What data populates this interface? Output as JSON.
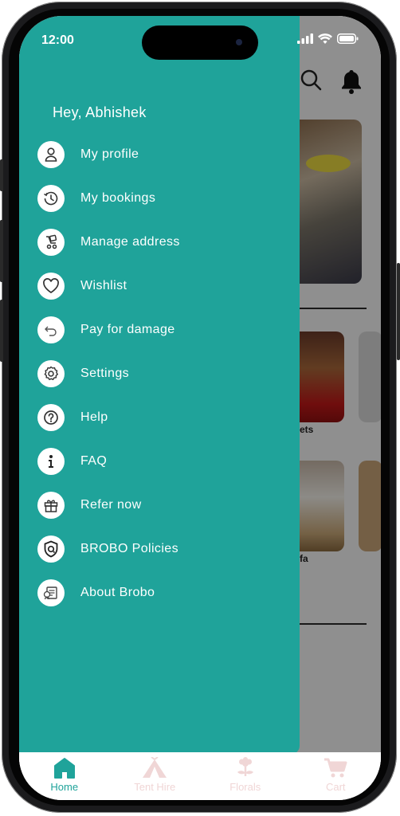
{
  "status_bar": {
    "time": "12:00"
  },
  "drawer": {
    "greeting": "Hey, Abhishek",
    "items": [
      {
        "label": "My profile",
        "icon": "person-icon"
      },
      {
        "label": "My bookings",
        "icon": "clock-history-icon"
      },
      {
        "label": "Manage address",
        "icon": "address-cart-icon"
      },
      {
        "label": "Wishlist",
        "icon": "heart-icon"
      },
      {
        "label": "Pay for damage",
        "icon": "return-arrow-icon"
      },
      {
        "label": "Settings",
        "icon": "gear-icon"
      },
      {
        "label": "Help",
        "icon": "help-icon"
      },
      {
        "label": "FAQ",
        "icon": "info-icon"
      },
      {
        "label": "Refer now",
        "icon": "gift-icon"
      },
      {
        "label": "BROBO Policies",
        "icon": "shield-icon"
      },
      {
        "label": "About Brobo",
        "icon": "document-icon"
      }
    ]
  },
  "background": {
    "card_label_1": "ets",
    "card_label_2": "fa"
  },
  "bottom_nav": {
    "items": [
      {
        "label": "Home",
        "icon": "home-icon",
        "active": true
      },
      {
        "label": "Tent Hire",
        "icon": "tent-icon",
        "active": false
      },
      {
        "label": "Florals",
        "icon": "flower-icon",
        "active": false
      },
      {
        "label": "Cart",
        "icon": "cart-icon",
        "active": false
      }
    ]
  },
  "colors": {
    "accent": "#1fa39a",
    "inactive_nav": "#f0d6d6",
    "drawer_text": "#ffffff"
  }
}
